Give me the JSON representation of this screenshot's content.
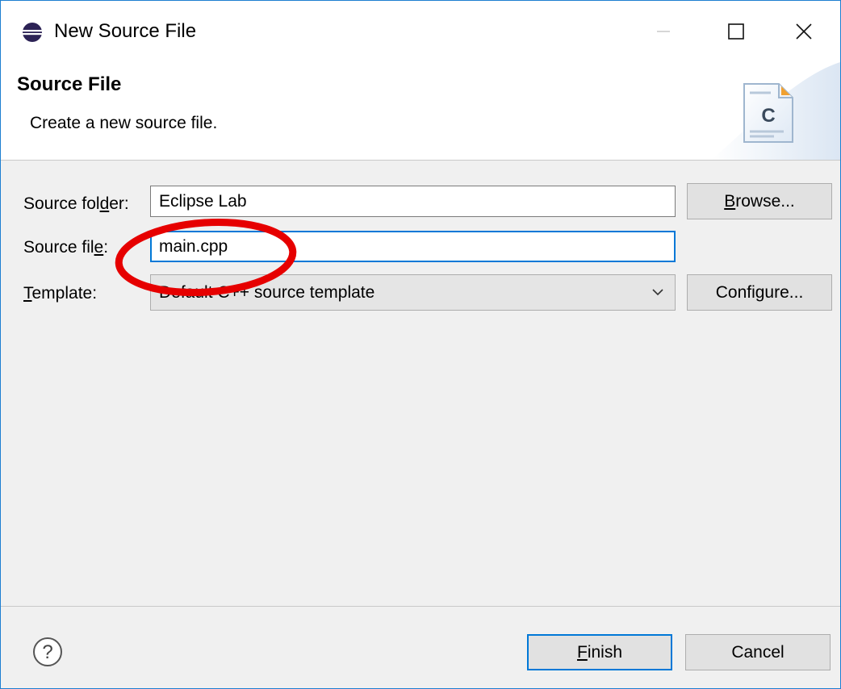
{
  "window": {
    "title": "New Source File",
    "icon": "eclipse-icon",
    "controls": [
      "minimize-icon",
      "maximize-icon",
      "close-icon"
    ]
  },
  "header": {
    "title": "Source File",
    "description": "Create a new source file.",
    "wizard_icon": "c-source-file-icon",
    "wizard_icon_letter": "C"
  },
  "form": {
    "source_folder": {
      "label_before": "Source fol",
      "label_mnemonic": "d",
      "label_after": "er:",
      "value": "Eclipse Lab",
      "button_mnemonic": "B",
      "button_rest": "rowse..."
    },
    "source_file": {
      "label_before": "Source fil",
      "label_mnemonic": "e",
      "label_after": ":",
      "value": "main.cpp"
    },
    "template": {
      "label_mnemonic": "T",
      "label_rest": "emplate:",
      "value": "Default C++ source template",
      "button_label": "Configure..."
    }
  },
  "footer": {
    "help_icon": "help-icon",
    "finish_mnemonic": "F",
    "finish_rest": "inish",
    "cancel_label": "Cancel"
  },
  "annotation": {
    "shape": "ellipse",
    "color": "#e60000",
    "target": "source-file-label"
  },
  "colors": {
    "accent": "#0078d7",
    "window_border": "#1d7fd1",
    "dialog_background": "#f0f0f0"
  }
}
